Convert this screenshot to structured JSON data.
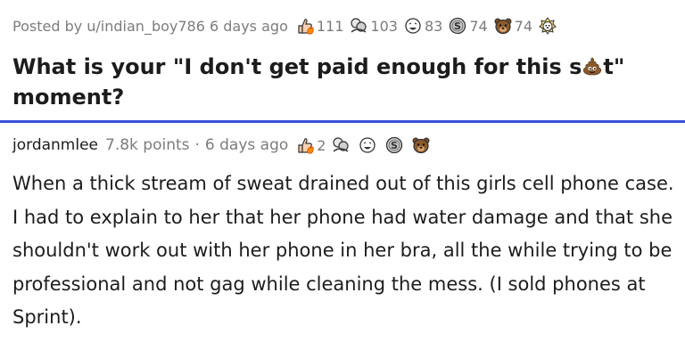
{
  "post": {
    "posted_by": "Posted by u/indian_boy786",
    "time": "6 days ago",
    "awards": [
      {
        "icon": "thumbs-up-flame-icon",
        "count": "111"
      },
      {
        "icon": "hug-icon",
        "count": "103"
      },
      {
        "icon": "laughing-face-icon",
        "count": "83"
      },
      {
        "icon": "silver-coin-icon",
        "count": "74"
      },
      {
        "icon": "bear-face-icon",
        "count": "74"
      },
      {
        "icon": "rocket-dog-icon",
        "count": ""
      }
    ],
    "title_before": "What is your \"I don't get paid enough for this s",
    "title_after": "t\"",
    "title_line2": "moment?"
  },
  "comment": {
    "author": "jordanmlee",
    "points": "7.8k points",
    "separator": "·",
    "time": "6 days ago",
    "awards": [
      {
        "icon": "thumbs-up-flame-icon",
        "count": "2"
      },
      {
        "icon": "hug-icon",
        "count": ""
      },
      {
        "icon": "laughing-face-icon",
        "count": ""
      },
      {
        "icon": "silver-coin-icon",
        "count": ""
      },
      {
        "icon": "bear-face-icon",
        "count": ""
      }
    ],
    "body": "When a thick stream of sweat drained out of this girls cell phone case. I had to explain to her that her phone had water damage and that she shouldn't work out with her phone in her bra, all the while trying to be professional and not gag while cleaning the mess. (I sold phones at Sprint)."
  },
  "colors": {
    "divider": "#3752d8",
    "meta_text": "#7c7c7c",
    "body_text": "#1c1c1c"
  }
}
